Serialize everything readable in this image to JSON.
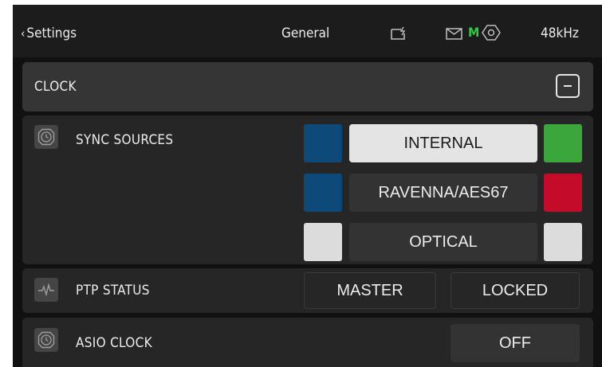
{
  "topbar": {
    "back_chevron": "‹",
    "back_label": "Settings",
    "title": "General",
    "status_badge": "M",
    "status_badge_color": "#2ecc40",
    "sample_rate": "48kHz"
  },
  "clock_section": {
    "title": "CLOCK",
    "collapse_icon": "minus-icon"
  },
  "sync_sources": {
    "label": "SYNC SOURCES",
    "icon": "clock-icon",
    "sources": [
      {
        "name": "INTERNAL",
        "selected": true,
        "left_indicator": "#0d4a7a",
        "right_indicator": "#3aa63c"
      },
      {
        "name": "RAVENNA/AES67",
        "selected": false,
        "left_indicator": "#0d4a7a",
        "right_indicator": "#c40c2a"
      },
      {
        "name": "OPTICAL",
        "selected": false,
        "left_indicator": "#dcdcdc",
        "right_indicator": "#dcdcdc"
      }
    ]
  },
  "ptp_status": {
    "label": "PTP STATUS",
    "icon": "waveform-icon",
    "role": "MASTER",
    "state": "LOCKED"
  },
  "asio_clock": {
    "label": "ASIO CLOCK",
    "icon": "clock-icon",
    "value": "OFF"
  },
  "colors": {
    "background": "#111111",
    "panel": "#262626",
    "selected_button": "#e4e4e4",
    "unselected_button": "#333333"
  }
}
